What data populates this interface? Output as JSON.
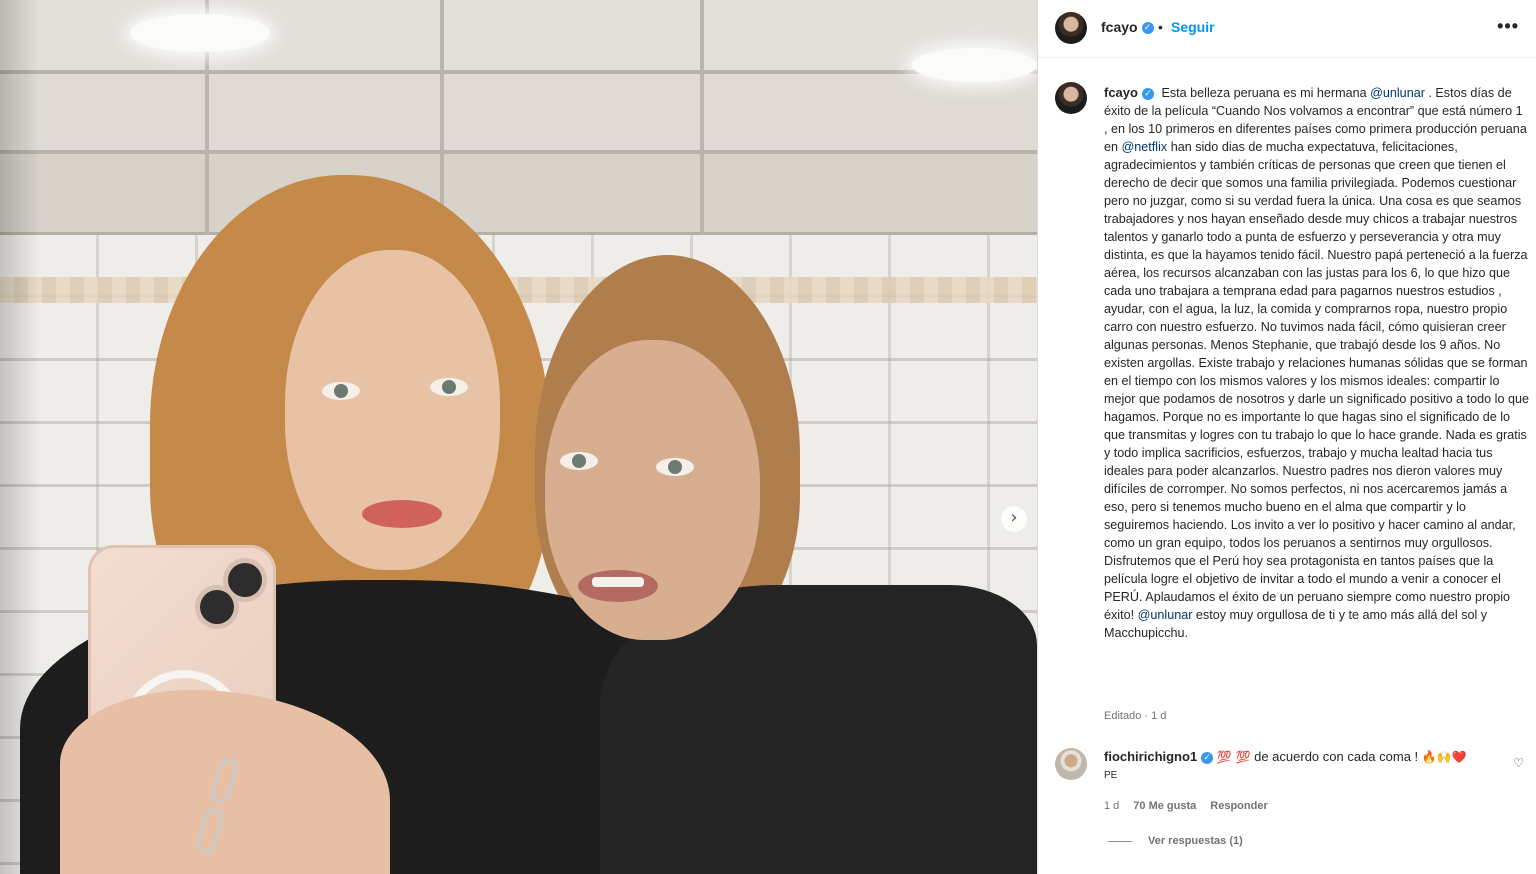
{
  "post": {
    "username": "fcayo",
    "follow_label": "Seguir",
    "more_icon": "•••",
    "nav_arrow": "›"
  },
  "caption": {
    "username": "fcayo",
    "part1": "Esta belleza peruana es mi hermana ",
    "mention1": "@unlunar",
    "part2": " . Estos días de éxito de la película “Cuando Nos volvamos a encontrar” que está número 1 , en los 10 primeros en diferentes países como primera producción peruana en ",
    "mention2": "@netflix",
    "part3": " han sido dias de mucha expectatuva, felicitaciones, agradecimientos y también críticas de personas que creen que tienen el derecho de decir que somos una familia privilegiada. Podemos cuestionar pero no juzgar, como si su verdad fuera la única. Una cosa es que seamos trabajadores y nos hayan enseñado desde muy chicos a trabajar nuestros talentos y ganarlo todo a punta de esfuerzo y perseverancia y otra muy distinta, es que la hayamos tenido fácil. Nuestro papá perteneció a la fuerza aérea, los recursos alcanzaban con las justas para los 6, lo que hizo que cada uno trabajara a temprana edad para pagarnos nuestros estudios , ayudar, con el agua, la luz, la comida y comprarnos ropa, nuestro propio carro con nuestro esfuerzo. No tuvimos nada fácil, cómo quisieran creer algunas personas. Menos Stephanie, que trabajó desde los 9 años. No existen argollas. Existe trabajo y relaciones humanas sólidas que se forman en el tiempo con los mismos valores y los mismos ideales: compartir lo mejor que podamos de nosotros y darle un significado positivo a todo lo que hagamos. Porque no es importante lo que hagas sino el significado de lo que transmitas y logres con tu trabajo lo que lo hace grande. Nada es gratis y todo implica sacrificios, esfuerzos, trabajo y mucha lealtad hacia tus ideales para poder alcanzarlos. Nuestro padres nos dieron valores muy difíciles de corromper. No somos perfectos, ni nos acercaremos jamás a eso, pero si tenemos mucho bueno en el alma que compartir y lo seguiremos haciendo. Los invito a ver lo positivo y hacer camino al andar, como un gran equipo, todos los peruanos a sentirnos muy orgullosos. Disfrutemos que el Perú hoy sea protagonista en tantos países que la película logre el objetivo de invitar a todo el mundo a venir a conocer el PERÚ. Aplaudamos el éxito de un peruano siempre como nuestro propio éxito! ",
    "mention3": "@unlunar",
    "part4": " estoy muy orgullosa de ti y te amo más allá del sol y Macchupicchu.",
    "meta": "Editado · 1 d"
  },
  "comment": {
    "username": "fiochirichigno1",
    "emoji_before": "💯 💯",
    "text": " de acuerdo con cada coma ! ",
    "emoji_after": "🔥🙌❤️",
    "sub": "PE",
    "time": "1 d",
    "likes": "70 Me gusta",
    "reply": "Responder",
    "view_replies": "Ver respuestas (1)"
  },
  "icons": {
    "verified": "✓",
    "heart": "♡"
  }
}
